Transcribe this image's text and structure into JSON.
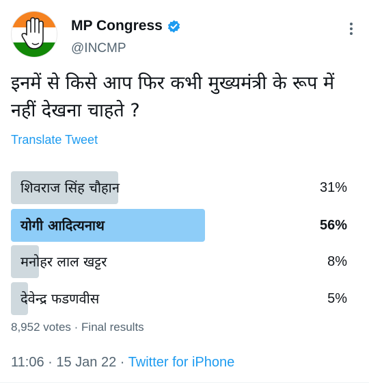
{
  "author": {
    "name": "MP Congress",
    "handle": "@INCMP",
    "verified": true,
    "avatar_colors": {
      "saffron": "#f58220",
      "green": "#138808",
      "white": "#ffffff"
    }
  },
  "tweet": {
    "text": "इनमें से किसे आप फिर कभी मुख्यमंत्री के रूप में नहीं देखना चाहते ?",
    "translate_label": "Translate Tweet"
  },
  "poll": {
    "options": [
      {
        "label": "शिवराज सिंह चौहान",
        "percent_label": "31%",
        "percent": 31,
        "winner": false
      },
      {
        "label": "योगी आदित्यनाथ",
        "percent_label": "56%",
        "percent": 56,
        "winner": true
      },
      {
        "label": "मनोहर लाल खट्टर",
        "percent_label": "8%",
        "percent": 8,
        "winner": false
      },
      {
        "label": "देवेन्द्र फडणवीस",
        "percent_label": "5%",
        "percent": 5,
        "winner": false
      }
    ],
    "votes": "8,952 votes",
    "status": "Final results"
  },
  "meta": {
    "time": "11:06",
    "date": "15 Jan 22",
    "source": "Twitter for iPhone"
  },
  "colors": {
    "accent": "#1d9bf0",
    "bar_default": "#cfd9de",
    "bar_winner": "#8ecdf8",
    "muted_text": "#536471"
  }
}
